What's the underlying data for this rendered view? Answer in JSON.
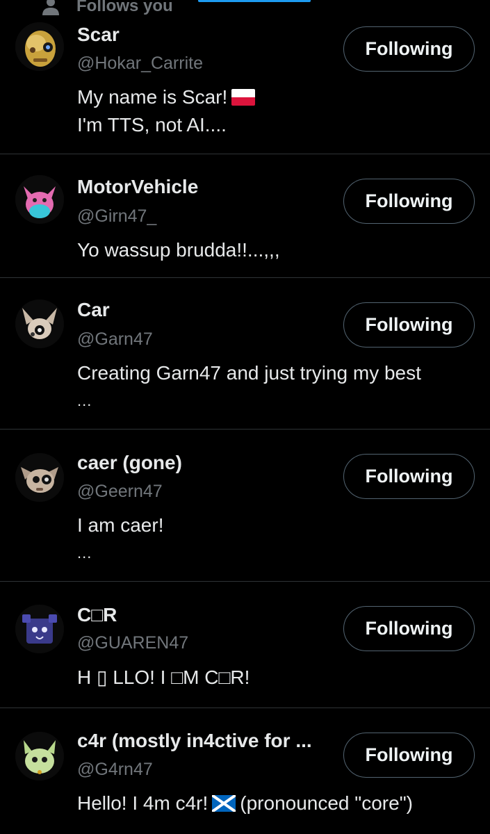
{
  "header": {
    "follows_you": "Follows you"
  },
  "accounts": [
    {
      "name": "Scar",
      "handle": "@Hokar_Carrite",
      "bio_lines": [
        "My name is Scar!",
        "I'm TTS, not AI...."
      ],
      "bio_flag": "poland-flag",
      "button": "Following",
      "avatar": "yellow-skull-avatar"
    },
    {
      "name": "MotorVehicle",
      "handle": "@Girn47_",
      "bio_lines": [
        "Yo wassup brudda!!...,,,"
      ],
      "button": "Following",
      "avatar": "pink-creature-avatar"
    },
    {
      "name": "Car",
      "handle": "@Garn47",
      "bio_lines": [
        "Creating Garn47 and just trying my best",
        "..."
      ],
      "button": "Following",
      "avatar": "fox-creature-avatar"
    },
    {
      "name": "caer (gone)",
      "handle": "@Geern47",
      "bio_lines": [
        "I am caer!",
        "..."
      ],
      "button": "Following",
      "avatar": "cat-creature-avatar"
    },
    {
      "name": "C□R",
      "handle": "@GUAREN47",
      "bio_lines": [
        "H ▯ LLO! I □M C□R!"
      ],
      "button": "Following",
      "avatar": "blue-cube-creature-avatar"
    },
    {
      "name": "c4r (mostly in4ctive for ...",
      "handle": "@G4rn47",
      "bio_lines": [
        "Hello! I 4m c4r!",
        "(pronounced \"core\")"
      ],
      "bio_flag": "scotland-flag",
      "button": "Following",
      "avatar": "green-creature-avatar"
    }
  ],
  "colors": {
    "background": "#000000",
    "primary_text": "#e7e9ea",
    "secondary_text": "#71767b",
    "divider": "#2f3336",
    "button_border": "#536471",
    "accent": "#1d9bf0"
  }
}
